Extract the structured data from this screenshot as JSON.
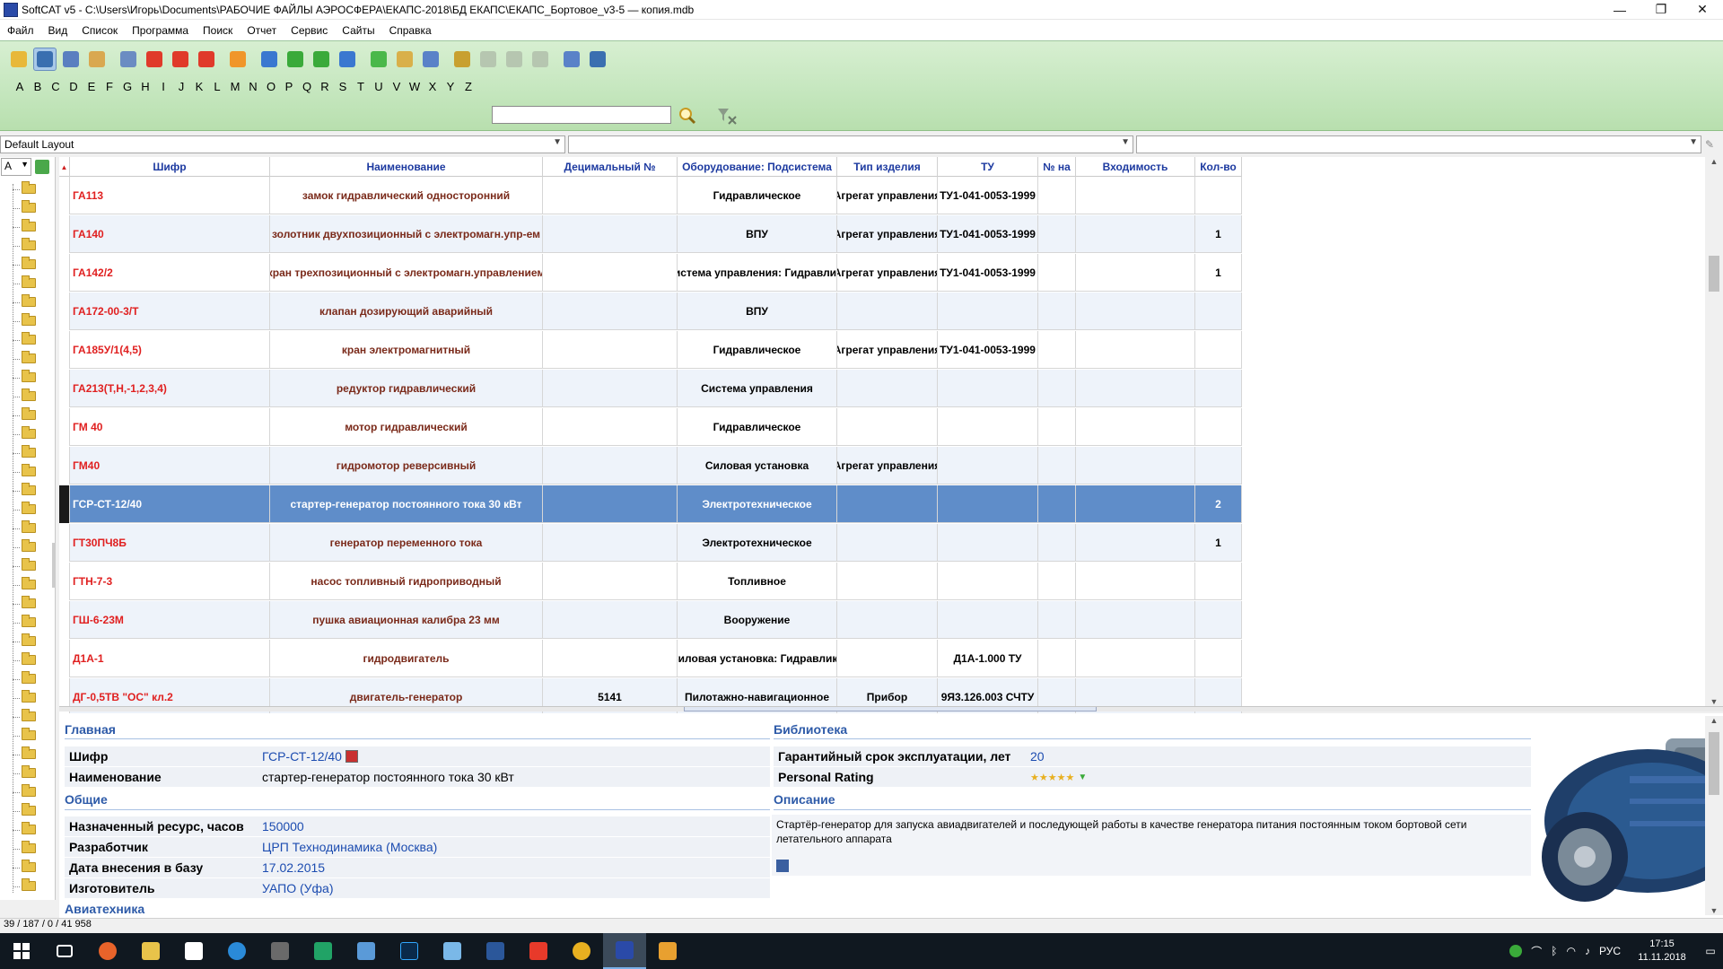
{
  "window": {
    "title": "SoftCAT v5 - C:\\Users\\Игорь\\Documents\\РАБОЧИЕ ФАЙЛЫ АЭРОСФЕРА\\ЕКАПС-2018\\БД ЕКАПС\\ЕКАПС_Бортовое_v3-5 — копия.mdb",
    "minimize": "—",
    "maximize": "❐",
    "close": "✕"
  },
  "menu": [
    "Файл",
    "Вид",
    "Список",
    "Программа",
    "Поиск",
    "Отчет",
    "Сервис",
    "Сайты",
    "Справка"
  ],
  "toolbar_icons": [
    "home-icon",
    "monitor-icon",
    "table-icon",
    "settings-icon",
    "zoom-icon",
    "add-icon",
    "up-icon",
    "remove-icon",
    "refresh-icon",
    "first-icon",
    "prev-icon",
    "next-icon",
    "last-icon",
    "check-icon",
    "edit-list-icon",
    "grid-icon",
    "link-icon",
    "back-arrow-icon",
    "forward-arrow-icon",
    "copy-icon",
    "export-icon",
    "chart-icon"
  ],
  "alphabet": [
    "A",
    "B",
    "C",
    "D",
    "E",
    "F",
    "G",
    "H",
    "I",
    "J",
    "K",
    "L",
    "M",
    "N",
    "O",
    "P",
    "Q",
    "R",
    "S",
    "T",
    "U",
    "V",
    "W",
    "X",
    "Y",
    "Z"
  ],
  "search": {
    "value": "",
    "placeholder": ""
  },
  "layout": {
    "value": "Default Layout",
    "combo2": "",
    "combo3": ""
  },
  "tree": {
    "letter": "A"
  },
  "grid": {
    "columns": [
      "Шифр",
      "Наименование",
      "Децимальный №",
      "Оборудование: Подсистема",
      "Тип изделия",
      "ТУ",
      "№ на",
      "Входимость",
      "Кол-во"
    ],
    "rows": [
      {
        "code": "ГА113",
        "name": "замок гидравлический односторонний",
        "dec": "",
        "equip": "Гидравлическое",
        "type": "Агрегат управления",
        "tu": "ТУ1-041-0053-1999",
        "no": "",
        "entry": "",
        "qty": ""
      },
      {
        "code": "ГА140",
        "name": "золотник двухпозиционный с электромагн.упр-ем",
        "dec": "",
        "equip": "ВПУ",
        "type": "Агрегат управления",
        "tu": "ТУ1-041-0053-1999",
        "no": "",
        "entry": "",
        "qty": "1"
      },
      {
        "code": "ГА142/2",
        "name": "кран трехпозиционный с электромагн.управлением",
        "dec": "",
        "equip": "Система управления: Гидравлика",
        "type": "Агрегат управления",
        "tu": "ТУ1-041-0053-1999",
        "no": "",
        "entry": "",
        "qty": "1"
      },
      {
        "code": "ГА172-00-3/Т",
        "name": "клапан дозирующий аварийный",
        "dec": "",
        "equip": "ВПУ",
        "type": "",
        "tu": "",
        "no": "",
        "entry": "",
        "qty": ""
      },
      {
        "code": "ГА185У/1(4,5)",
        "name": "кран электромагнитный",
        "dec": "",
        "equip": "Гидравлическое",
        "type": "Агрегат управления",
        "tu": "ТУ1-041-0053-1999",
        "no": "",
        "entry": "",
        "qty": ""
      },
      {
        "code": "ГА213(Т,Н,-1,2,3,4)",
        "name": "редуктор гидравлический",
        "dec": "",
        "equip": "Система управления",
        "type": "",
        "tu": "",
        "no": "",
        "entry": "",
        "qty": ""
      },
      {
        "code": "ГМ 40",
        "name": "мотор гидравлический",
        "dec": "",
        "equip": "Гидравлическое",
        "type": "",
        "tu": "",
        "no": "",
        "entry": "",
        "qty": ""
      },
      {
        "code": "ГМ40",
        "name": "гидромотор реверсивный",
        "dec": "",
        "equip": "Силовая установка",
        "type": "Агрегат управления",
        "tu": "",
        "no": "",
        "entry": "",
        "qty": ""
      },
      {
        "code": "ГСР-СТ-12/40",
        "name": "стартер-генератор постоянного тока 30 кВт",
        "dec": "",
        "equip": "Электротехническое",
        "type": "",
        "tu": "",
        "no": "",
        "entry": "",
        "qty": "2"
      },
      {
        "code": "ГТ30ПЧ8Б",
        "name": "генератор переменного тока",
        "dec": "",
        "equip": "Электротехническое",
        "type": "",
        "tu": "",
        "no": "",
        "entry": "",
        "qty": "1"
      },
      {
        "code": "ГТН-7-3",
        "name": "насос топливный гидроприводный",
        "dec": "",
        "equip": "Топливное",
        "type": "",
        "tu": "",
        "no": "",
        "entry": "",
        "qty": ""
      },
      {
        "code": "ГШ-6-23М",
        "name": "пушка авиационная калибра 23 мм",
        "dec": "",
        "equip": "Вооружение",
        "type": "",
        "tu": "",
        "no": "",
        "entry": "",
        "qty": ""
      },
      {
        "code": "Д1А-1",
        "name": "гидродвигатель",
        "dec": "",
        "equip": "Силовая установка: Гидравлика",
        "type": "",
        "tu": "Д1А-1.000 ТУ",
        "no": "",
        "entry": "",
        "qty": ""
      },
      {
        "code": "ДГ-0,5ТВ \"ОС\" кл.2",
        "name": "двигатель-генератор",
        "dec": "5141",
        "equip": "Пилотажно-навигационное",
        "type": "Прибор",
        "tu": "9Я3.126.003 СЧТУ",
        "no": "",
        "entry": "",
        "qty": ""
      }
    ]
  },
  "details": {
    "main_section": "Главная",
    "code_label": "Шифр",
    "code_value": "ГСР-СТ-12/40",
    "name_label": "Наименование",
    "name_value": "стартер-генератор постоянного тока 30 кВт",
    "general_section": "Общие",
    "resource_label": "Назначенный ресурс, часов",
    "resource_value": "150000",
    "dev_label": "Разработчик",
    "dev_value": "ЦРП Технодинамика (Москва)",
    "date_label": "Дата внесения в базу",
    "date_value": "17.02.2015",
    "maker_label": "Изготовитель",
    "maker_value": "УАПО (Уфа)",
    "aviation_section": "Авиатехника",
    "library_section": "Библиотека",
    "warranty_label": "Гарантийный срок эксплуатации, лет",
    "warranty_value": "20",
    "rating_label": "Personal Rating",
    "rating_stars": 5,
    "rating_text": "★★★★★",
    "description_section": "Описание",
    "description": "Стартёр-генератор для запуска авиадвигателей и последующей работы в качестве генератора питания постоянным током бортовой сети летательного аппарата"
  },
  "status": {
    "text": "39 / 187 / 0 / 41 958"
  },
  "taskbar": {
    "icons": [
      "start-icon",
      "task-view-icon",
      "firefox-icon",
      "explorer-icon",
      "store-icon",
      "edge-icon",
      "app-icon",
      "excel-icon",
      "app2-icon",
      "photoshop-icon",
      "app3-icon",
      "word-icon",
      "pdf-icon",
      "chrome-icon",
      "softcat-icon",
      "media-icon"
    ],
    "lang": "РУС",
    "time": "17:15",
    "date": "11.11.2018"
  },
  "colors": {
    "code_red": "#e02020",
    "name_brown": "#7a2a1a",
    "header_blue": "#1d3aa0",
    "selected_row": "#5f8dc9",
    "toolbar_green": "#c4e6bd"
  }
}
